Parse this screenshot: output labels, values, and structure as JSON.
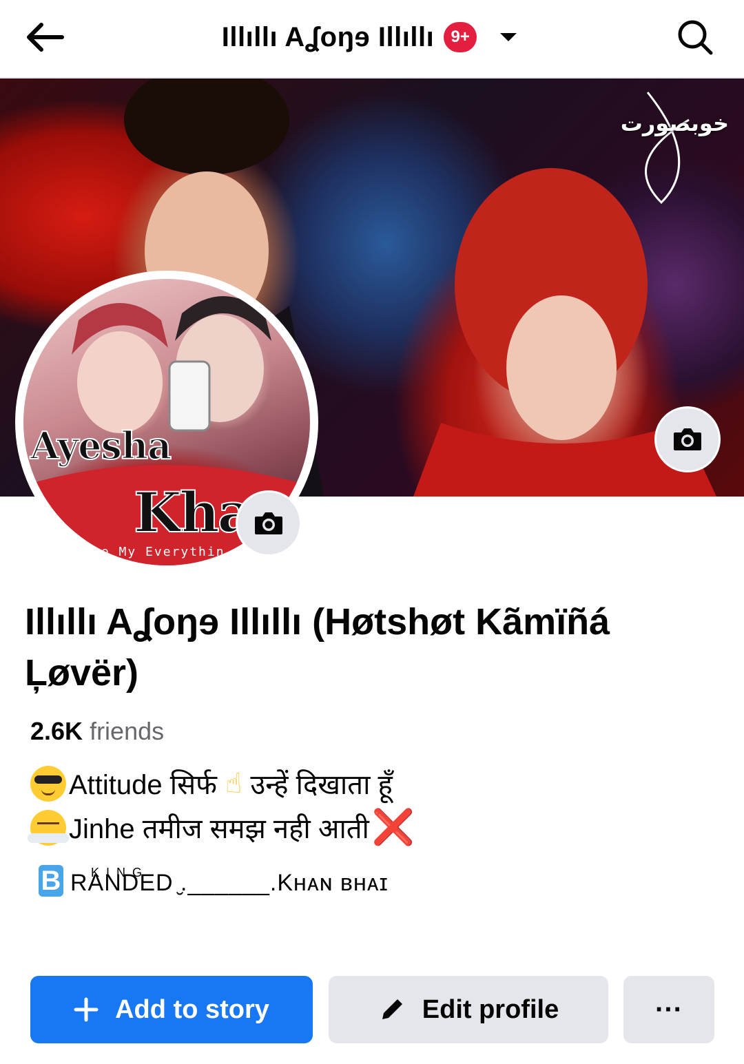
{
  "header": {
    "title": "Illıllı Aʆoŋɘ Illıllı",
    "notification_badge": "9+",
    "icons": [
      "back-arrow-icon",
      "caret-down-icon",
      "search-icon"
    ]
  },
  "cover": {
    "overlay_text": "خوبصورت",
    "camera_icon": "camera-icon"
  },
  "avatar": {
    "name_line1": "Ayesha",
    "name_line2": "Kha",
    "tagline": "re My Everythin",
    "camera_icon": "camera-icon"
  },
  "profile": {
    "name": "Illıllı Aʆoŋɘ Illıllı (Høtshøt Kãmïñá Ļøvër)",
    "friends_count": "2.6K",
    "friends_label": "friends"
  },
  "bio": {
    "line1_text_a": "Attitude सिर्फ",
    "line1_hand": "☝",
    "line1_text_b": "उन्हें दिखाता हूँ",
    "line2_text": "Jinhe तमीज समझ नही आती",
    "line2_mark": "❌",
    "brand_letter": "B",
    "brand_superscript": "KING",
    "brand_text": "RANDED ̮.______.Kʜᴀɴ ʙʜᴀɪ"
  },
  "actions": {
    "add_story_label": "Add to story",
    "edit_profile_label": "Edit profile",
    "more_label": "···"
  },
  "colors": {
    "primary_blue": "#1877f2",
    "badge_red": "#e41e3f",
    "button_gray": "#e4e6eb"
  }
}
